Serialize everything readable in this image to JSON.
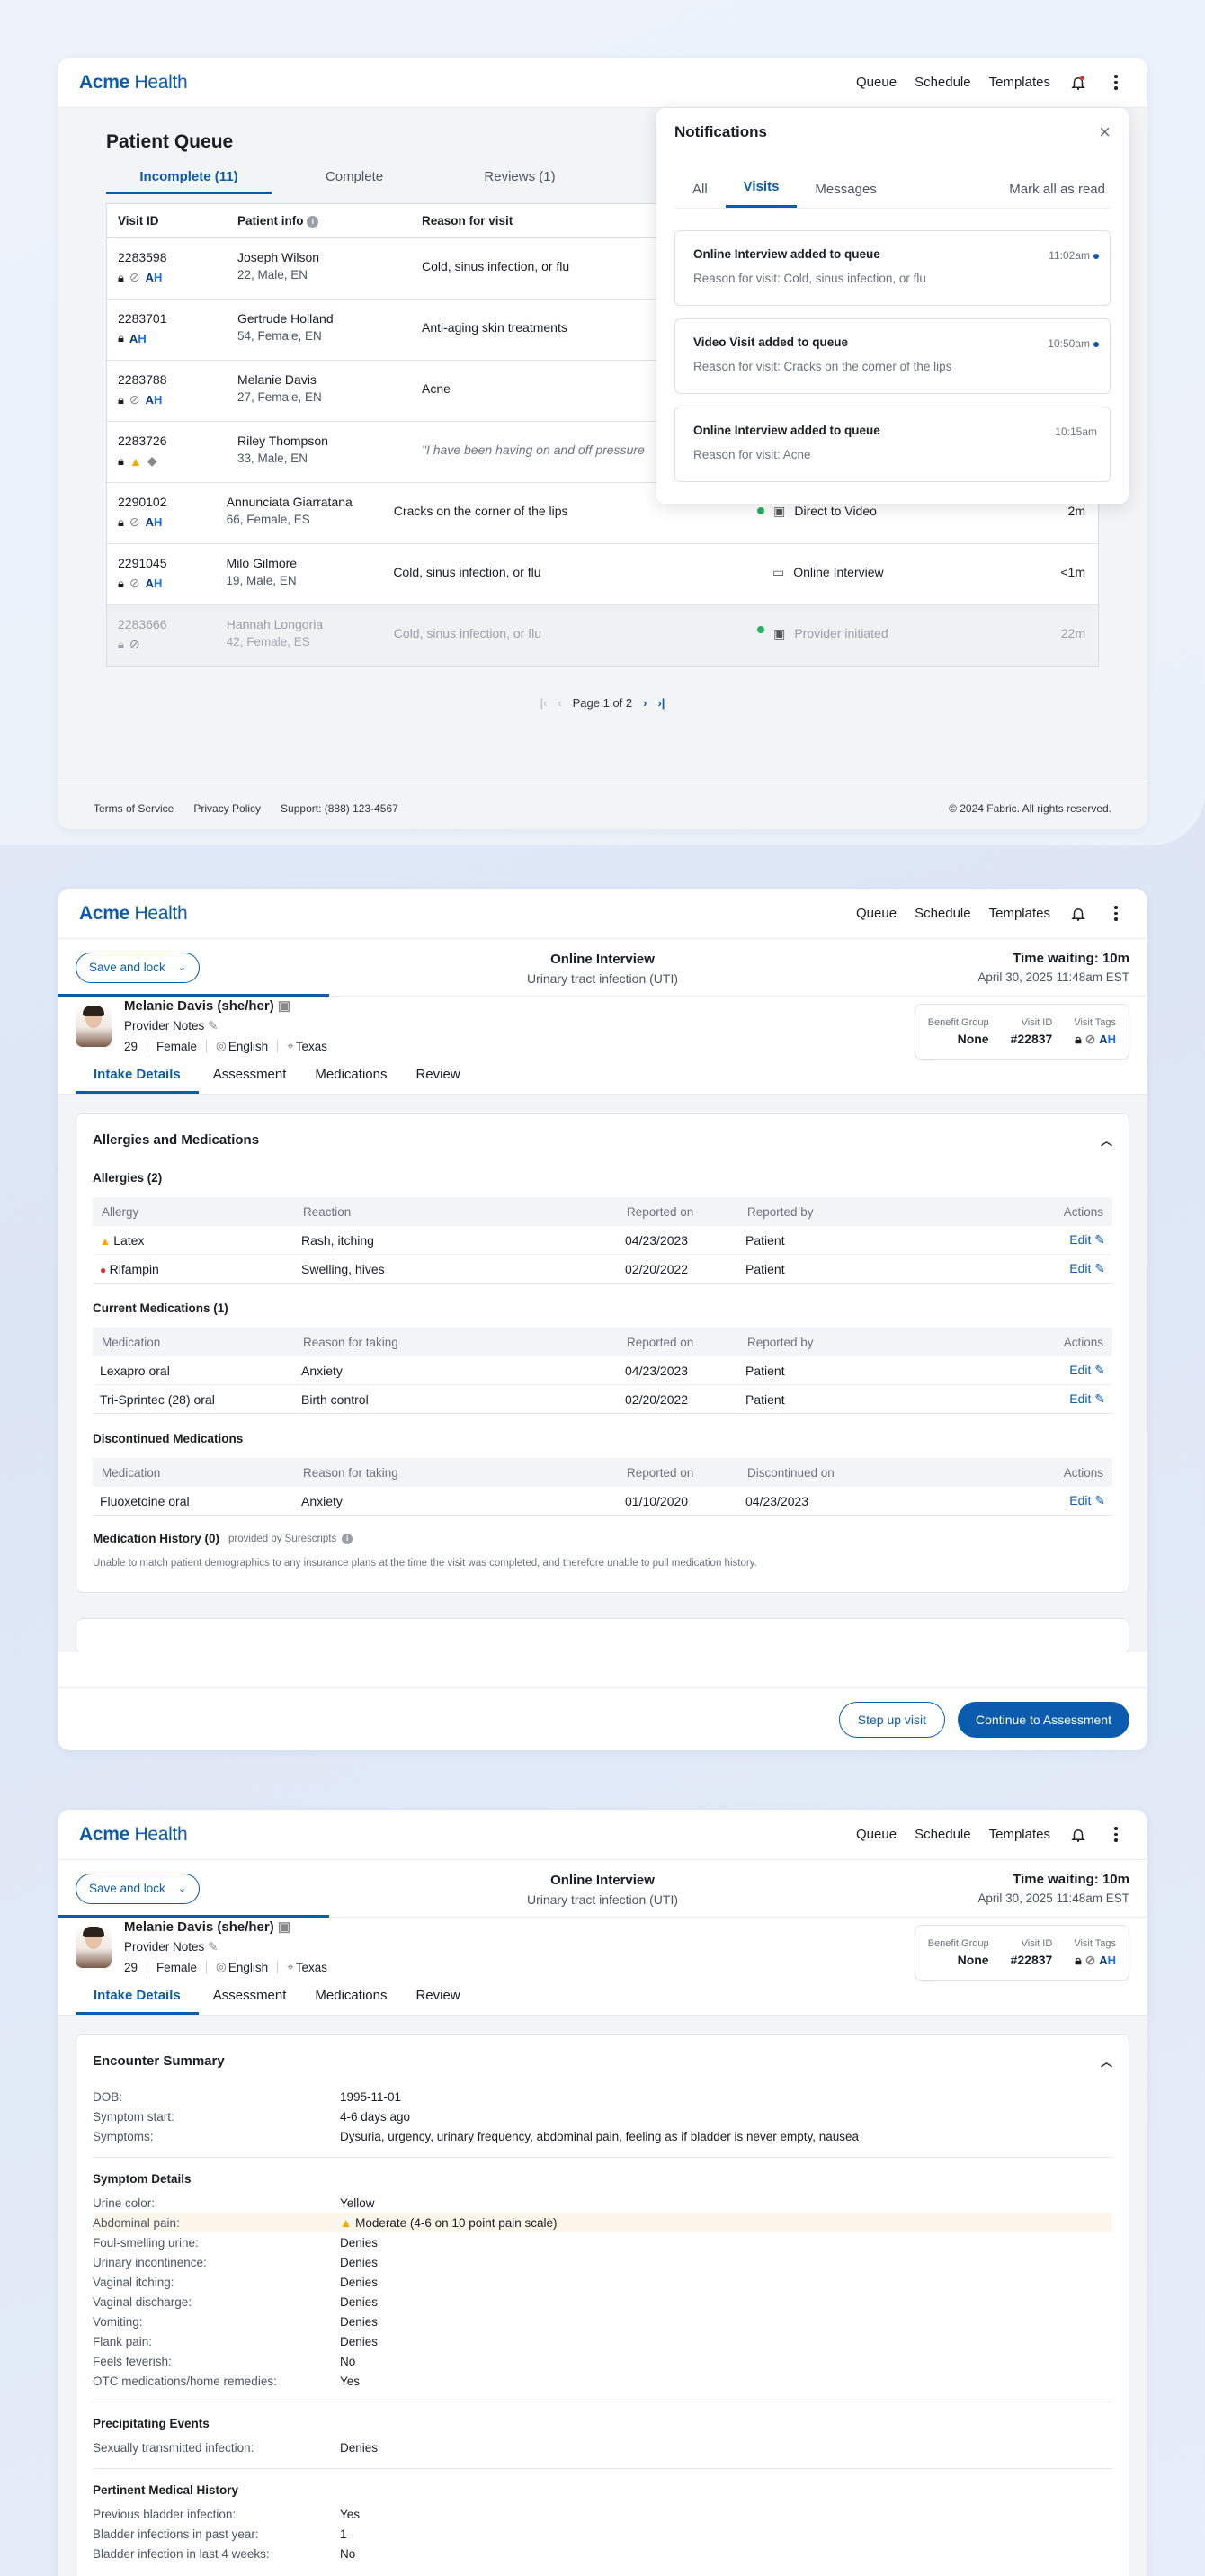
{
  "brand": {
    "name_bold": "Acme",
    "name_rest": " Health"
  },
  "nav": {
    "queue": "Queue",
    "schedule": "Schedule",
    "templates": "Templates"
  },
  "queue": {
    "title": "Patient Queue",
    "tabs": [
      "Incomplete (11)",
      "Complete",
      "Reviews (1)"
    ],
    "columns": {
      "visit_id": "Visit ID",
      "patient_info": "Patient info",
      "reason": "Reason for visit"
    },
    "rows": [
      {
        "id": "2283598",
        "name": "Joseph Wilson",
        "details": "22, Male, EN",
        "reason": "Cold, sinus infection, or flu",
        "type": "",
        "time": ""
      },
      {
        "id": "2283701",
        "name": "Gertrude Holland",
        "details": "54, Female, EN",
        "reason": "Anti-aging skin treatments",
        "type": "",
        "time": ""
      },
      {
        "id": "2283788",
        "name": "Melanie Davis",
        "details": "27, Female, EN",
        "reason": "Acne",
        "type": "",
        "time": ""
      },
      {
        "id": "2283726",
        "name": "Riley Thompson",
        "details": "33, Male, EN",
        "reason": "\"I have been having on and off pressure",
        "type": "",
        "time": ""
      },
      {
        "id": "2290102",
        "name": "Annunciata Giarratana",
        "details": "66, Female, ES",
        "reason": "Cracks on the corner of the lips",
        "type": "Direct to Video",
        "time": "2m"
      },
      {
        "id": "2291045",
        "name": "Milo Gilmore",
        "details": "19, Male, EN",
        "reason": "Cold, sinus infection, or flu",
        "type": "Online Interview",
        "time": "<1m"
      },
      {
        "id": "2283666",
        "name": "Hannah Longoria",
        "details": "42, Female, ES",
        "reason": "Cold, sinus infection, or flu",
        "type": "Provider initiated",
        "time": "22m"
      }
    ],
    "pager": "Page 1 of 2",
    "ah_a": "A",
    "ah_h": "H"
  },
  "footer": {
    "terms": "Terms of Service",
    "privacy": "Privacy Policy",
    "support": "Support: (888) 123-4567",
    "copyright": "© 2024 Fabric. All rights reserved."
  },
  "notifications": {
    "title": "Notifications",
    "tabs": [
      "All",
      "Visits",
      "Messages"
    ],
    "mark_all": "Mark all as read",
    "items": [
      {
        "title": "Online Interview added to queue",
        "sub": "Reason for visit: Cold, sinus infection, or flu",
        "time": "11:02am"
      },
      {
        "title": "Video Visit added to queue",
        "sub": "Reason for visit: Cracks on the corner of the lips",
        "time": "10:50am"
      },
      {
        "title": "Online Interview added to queue",
        "sub": "Reason for visit: Acne",
        "time": "10:15am"
      }
    ]
  },
  "visit": {
    "save_lock": "Save and lock",
    "type": "Online Interview",
    "condition": "Urinary tract infection (UTI)",
    "waiting": "Time waiting: 10m",
    "datetime": "April 30, 2025   11:48am EST",
    "patient_name": "Melanie Davis (she/her)",
    "provider_notes": "Provider Notes",
    "age": "29",
    "sex": "Female",
    "lang": "English",
    "state": "Texas",
    "benefit_label": "Benefit Group",
    "benefit_val": "None",
    "visit_label": "Visit ID",
    "visit_val": "#22837",
    "tags_label": "Visit Tags",
    "tabs": [
      "Intake Details",
      "Assessment",
      "Medications",
      "Review"
    ]
  },
  "allergies": {
    "panel_title": "Allergies and Medications",
    "allergies_title": "Allergies (2)",
    "allergy_cols": [
      "Allergy",
      "Reaction",
      "Reported on",
      "Reported by",
      "Actions"
    ],
    "allergy_rows": [
      [
        "Latex",
        "Rash, itching",
        "04/23/2023",
        "Patient",
        "Edit"
      ],
      [
        "Rifampin",
        "Swelling, hives",
        "02/20/2022",
        "Patient",
        "Edit"
      ]
    ],
    "current_title": "Current Medications (1)",
    "med_cols": [
      "Medication",
      "Reason for taking",
      "Reported on",
      "Reported by",
      "Actions"
    ],
    "current_rows": [
      [
        "Lexapro oral",
        "Anxiety",
        "04/23/2023",
        "Patient",
        "Edit"
      ],
      [
        "Tri-Sprintec (28) oral",
        "Birth control",
        "02/20/2022",
        "Patient",
        "Edit"
      ]
    ],
    "disc_title": "Discontinued Medications",
    "disc_cols": [
      "Medication",
      "Reason for taking",
      "Reported on",
      "Discontinued on",
      "Actions"
    ],
    "disc_rows": [
      [
        "Fluoxetoine oral",
        "Anxiety",
        "01/10/2020",
        "04/23/2023",
        "Edit"
      ]
    ],
    "history_title": "Medication History (0)",
    "history_provider": "provided by Surescripts",
    "history_note": "Unable to match patient demographics to any insurance plans at the time the visit was completed, and therefore unable to pull medication history."
  },
  "actions": {
    "step_up": "Step up visit",
    "continue": "Continue to Assessment"
  },
  "encounter": {
    "title": "Encounter Summary",
    "basics": [
      [
        "DOB:",
        "1995-11-01"
      ],
      [
        "Symptom start:",
        "4-6 days ago"
      ],
      [
        "Symptoms:",
        "Dysuria, urgency, urinary frequency, abdominal pain, feeling as if bladder is never empty, nausea"
      ]
    ],
    "symptom_title": "Symptom Details",
    "symptoms": [
      [
        "Urine color:",
        "Yellow"
      ],
      [
        "Abdominal pain:",
        "Moderate (4-6 on 10 point pain scale)"
      ],
      [
        "Foul-smelling urine:",
        "Denies"
      ],
      [
        "Urinary incontinence:",
        "Denies"
      ],
      [
        "Vaginal itching:",
        "Denies"
      ],
      [
        "Vaginal discharge:",
        "Denies"
      ],
      [
        "Vomiting:",
        "Denies"
      ],
      [
        "Flank pain:",
        "Denies"
      ],
      [
        "Feels feverish:",
        "No"
      ],
      [
        "OTC medications/home remedies:",
        "Yes"
      ]
    ],
    "precip_title": "Precipitating Events",
    "precip": [
      [
        "Sexually transmitted infection:",
        "Denies"
      ]
    ],
    "history_title": "Pertinent Medical History",
    "history": [
      [
        "Previous bladder infection:",
        "Yes"
      ],
      [
        "Bladder infections in past year:",
        "1"
      ],
      [
        "Bladder infection in last 4 weeks:",
        "No"
      ]
    ]
  }
}
